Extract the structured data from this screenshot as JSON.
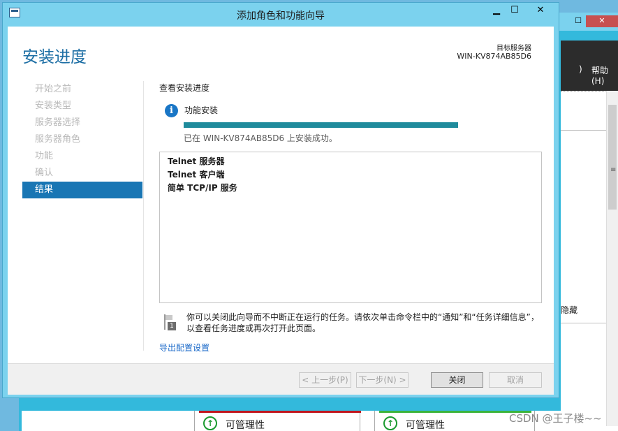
{
  "window": {
    "title": "添加角色和功能向导",
    "controls": {
      "minimize": "▁",
      "maximize": "☐",
      "close": "✕"
    }
  },
  "header": {
    "page_title": "安装进度",
    "target_label": "目标服务器",
    "target_value": "WIN-KV874AB85D6"
  },
  "nav": {
    "items": [
      {
        "label": "开始之前",
        "active": false
      },
      {
        "label": "安装类型",
        "active": false
      },
      {
        "label": "服务器选择",
        "active": false
      },
      {
        "label": "服务器角色",
        "active": false
      },
      {
        "label": "功能",
        "active": false
      },
      {
        "label": "确认",
        "active": false
      },
      {
        "label": "结果",
        "active": true
      }
    ]
  },
  "main": {
    "section_title": "查看安装进度",
    "install_label": "功能安装",
    "progress": 1.0,
    "install_status": "已在 WIN-KV874AB85D6 上安装成功。",
    "results": [
      "Telnet 服务器",
      "Telnet 客户端",
      "简单 TCP/IP 服务"
    ],
    "notice_badge": "1",
    "notice": "你可以关闭此向导而不中断正在运行的任务。请依次单击命令栏中的“通知”和“任务详细信息”，以查看任务进度或再次打开此页面。",
    "export_link": "导出配置设置"
  },
  "footer": {
    "prev_label": "< 上一步(P)",
    "next_label": "下一步(N) >",
    "finish_label": "关闭",
    "cancel_label": "取消"
  },
  "background": {
    "help_paren": ")",
    "help_label": "帮助(H)",
    "hide_label": "隐藏",
    "tile_1_label": "可管理性",
    "tile_2_label": "可管理性",
    "watermark": "CSDN @王子楼~~"
  },
  "colors": {
    "accent": "#1976b4",
    "progress": "#1f8b9c",
    "link": "#1b6ac9",
    "titlebar": "#7bd2ee"
  }
}
